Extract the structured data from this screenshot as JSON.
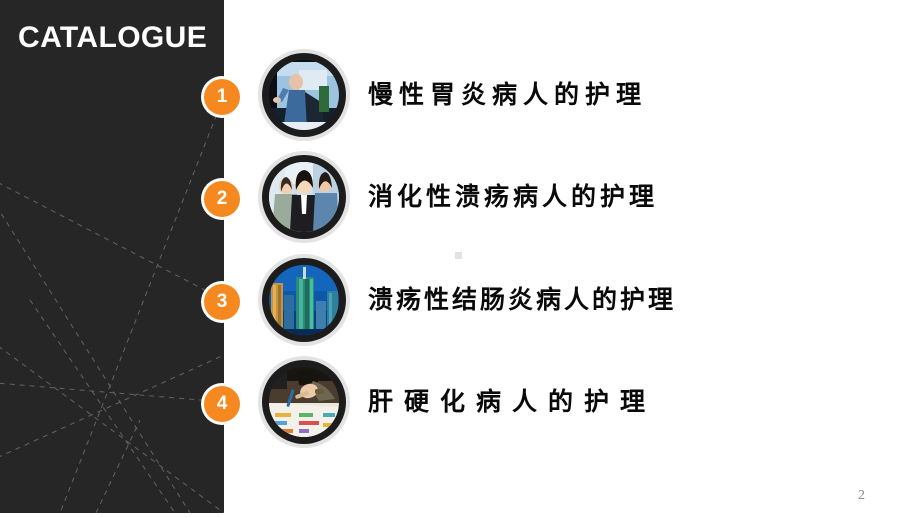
{
  "slide": {
    "title": "CATALOGUE",
    "page_number": "2",
    "background_color": "#ffffff",
    "panel_color": "#262626",
    "accent_color": "#f5881f",
    "text_color": "#0a0a0a"
  },
  "items": [
    {
      "number": "1",
      "label": "慢性胃炎病人的护理",
      "thumbnail": "photo-woman-presenting-icon"
    },
    {
      "number": "2",
      "label": "消化性溃疡病人的护理",
      "thumbnail": "photo-business-team-icon"
    },
    {
      "number": "3",
      "label": "溃疡性结肠炎病人的护理",
      "thumbnail": "photo-city-skyscrapers-icon"
    },
    {
      "number": "4",
      "label": "肝硬化病人的护理",
      "thumbnail": "photo-hands-writing-charts-icon"
    }
  ]
}
